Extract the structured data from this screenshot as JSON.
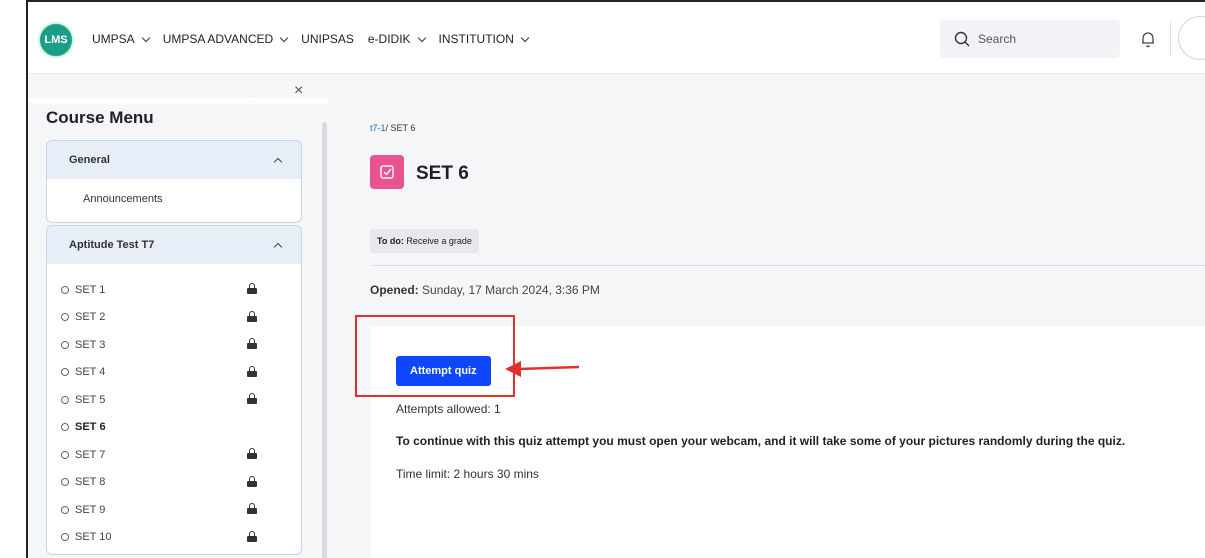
{
  "header": {
    "logo_text": "LMS",
    "menu": [
      {
        "label": "UMPSA",
        "dropdown": true
      },
      {
        "label": "UMPSA ADVANCED",
        "dropdown": true
      },
      {
        "label": "UNIPSAS",
        "dropdown": false
      },
      {
        "label": "e-DIDIK",
        "dropdown": true
      },
      {
        "label": "INSTITUTION",
        "dropdown": true
      }
    ],
    "search_placeholder": "Search"
  },
  "sidebar": {
    "close_glyph": "×",
    "title": "Course Menu",
    "sections": [
      {
        "title": "General",
        "items": [
          {
            "label": "Announcements"
          }
        ]
      },
      {
        "title": "Aptitude Test T7",
        "items": [
          {
            "label": "SET 1",
            "locked": true,
            "active": false
          },
          {
            "label": "SET 2",
            "locked": true,
            "active": false
          },
          {
            "label": "SET 3",
            "locked": true,
            "active": false
          },
          {
            "label": "SET 4",
            "locked": true,
            "active": false
          },
          {
            "label": "SET 5",
            "locked": true,
            "active": false
          },
          {
            "label": "SET 6",
            "locked": false,
            "active": true
          },
          {
            "label": "SET 7",
            "locked": true,
            "active": false
          },
          {
            "label": "SET 8",
            "locked": true,
            "active": false
          },
          {
            "label": "SET 9",
            "locked": true,
            "active": false
          },
          {
            "label": "SET 10",
            "locked": true,
            "active": false
          }
        ]
      }
    ]
  },
  "main": {
    "breadcrumb_link": "t7-1",
    "breadcrumb_current": "/ SET 6",
    "title": "SET 6",
    "todo_label": "To do:",
    "todo_text": "Receive a grade",
    "opened_label": "Opened:",
    "opened_value": "Sunday, 17 March 2024, 3:36 PM",
    "attempt_button": "Attempt quiz",
    "attempts_allowed": "Attempts allowed: 1",
    "notice": "To continue with this quiz attempt you must open your webcam, and it will take some of your pictures randomly during the quiz.",
    "time_limit": "Time limit: 2 hours 30 mins"
  },
  "colors": {
    "accent": "#0f47ff",
    "quiz_icon": "#e9538f",
    "annotation": "#e1312f",
    "logo": "#1a9e88"
  }
}
